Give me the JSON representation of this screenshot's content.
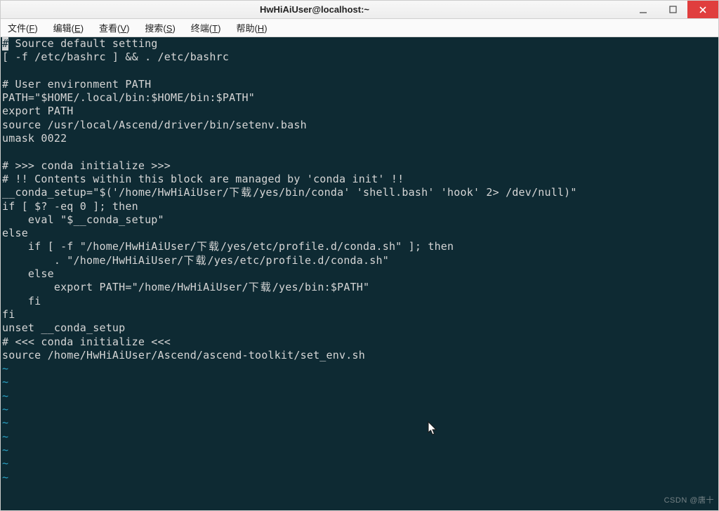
{
  "window": {
    "title": "HwHiAiUser@localhost:~"
  },
  "menubar": {
    "items": [
      {
        "label": "文件",
        "mnemonic": "F"
      },
      {
        "label": "编辑",
        "mnemonic": "E"
      },
      {
        "label": "查看",
        "mnemonic": "V"
      },
      {
        "label": "搜索",
        "mnemonic": "S"
      },
      {
        "label": "终端",
        "mnemonic": "T"
      },
      {
        "label": "帮助",
        "mnemonic": "H"
      }
    ]
  },
  "terminal": {
    "cursor_char": "#",
    "lines": [
      " Source default setting",
      "[ -f /etc/bashrc ] && . /etc/bashrc",
      "",
      "# User environment PATH",
      "PATH=\"$HOME/.local/bin:$HOME/bin:$PATH\"",
      "export PATH",
      "source /usr/local/Ascend/driver/bin/setenv.bash",
      "umask 0022",
      "",
      "# >>> conda initialize >>>",
      "# !! Contents within this block are managed by 'conda init' !!",
      "__conda_setup=\"$('/home/HwHiAiUser/下载/yes/bin/conda' 'shell.bash' 'hook' 2> /dev/null)\"",
      "if [ $? -eq 0 ]; then",
      "    eval \"$__conda_setup\"",
      "else",
      "    if [ -f \"/home/HwHiAiUser/下载/yes/etc/profile.d/conda.sh\" ]; then",
      "        . \"/home/HwHiAiUser/下载/yes/etc/profile.d/conda.sh\"",
      "    else",
      "        export PATH=\"/home/HwHiAiUser/下载/yes/bin:$PATH\"",
      "    fi",
      "fi",
      "unset __conda_setup",
      "# <<< conda initialize <<<",
      "source /home/HwHiAiUser/Ascend/ascend-toolkit/set_env.sh"
    ],
    "empty_line_marker": "~",
    "empty_line_count": 9
  },
  "watermark": "CSDN @唐十"
}
